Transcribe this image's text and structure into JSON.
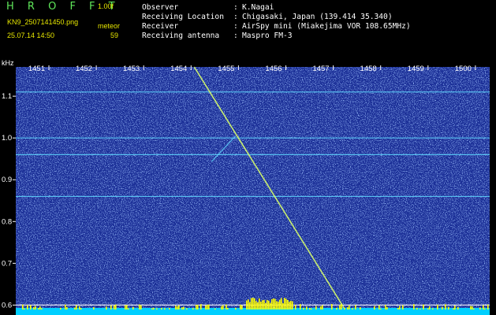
{
  "header": {
    "brand": "HROFFT",
    "version": "1.00f",
    "filename": "KN9_2507141450.png",
    "meteor_label": "meteor",
    "meteor_count": "59",
    "datetime": "25.07.14 14:50"
  },
  "info": [
    {
      "label": "Observer",
      "value": "K.Nagai"
    },
    {
      "label": "Receiving Location",
      "value": "Chigasaki, Japan (139.414 35.340)"
    },
    {
      "label": "Receiver",
      "value": "AirSpy mini (Miakejima VOR 108.65MHz)"
    },
    {
      "label": "Receiving antenna",
      "value": "Maspro FM-3"
    }
  ],
  "chart_data": {
    "type": "heatmap",
    "ylabel": "kHz",
    "x_ticks": [
      "1451",
      "1452",
      "1453",
      "1454",
      "1455",
      "1456",
      "1457",
      "1458",
      "1459",
      "1500"
    ],
    "y_ticks": [
      "1.1",
      "1.0",
      "0.9",
      "0.8",
      "0.7",
      "0.6"
    ],
    "y_range_khz": [
      0.58,
      1.17
    ],
    "horizontal_lines_khz": [
      1.11,
      1.0,
      0.96,
      0.86,
      0.6
    ],
    "meteor_trail": {
      "start_time": "1454",
      "start_khz": 1.17,
      "end_time": "14:57:20",
      "end_khz": 0.58
    },
    "colors": {
      "background": "#1b2f97",
      "noise_bright": "#6da7ff",
      "lines": "#5fd8ff",
      "trail": "#d8ff6a",
      "bottom_bar": "#00cfff",
      "burst": "#ffff00"
    }
  }
}
